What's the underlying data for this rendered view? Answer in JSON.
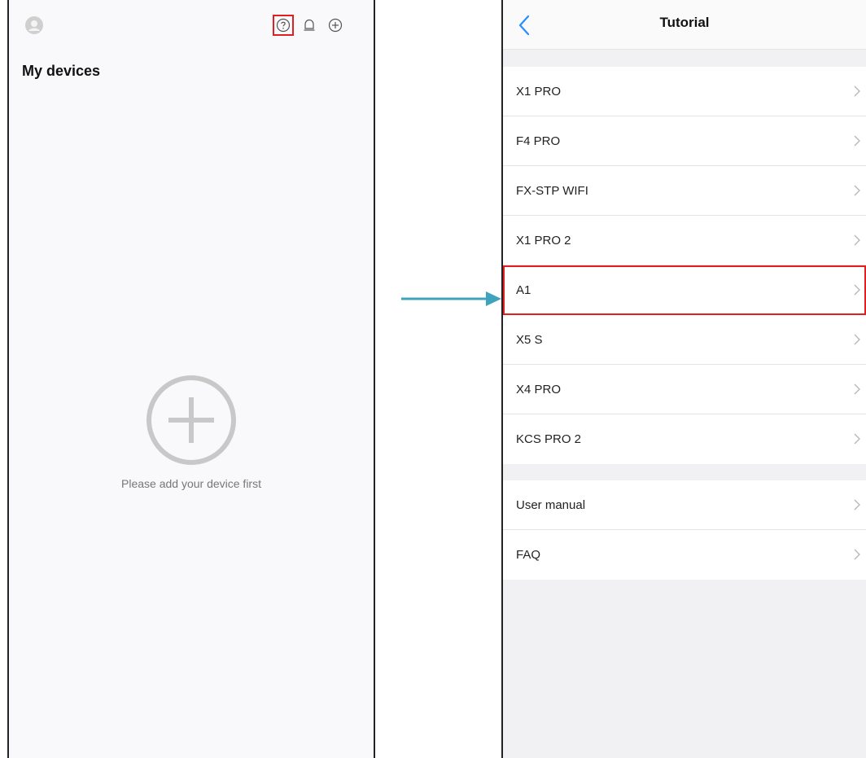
{
  "left": {
    "title": "My devices",
    "empty_message": "Please add your device first",
    "icons": {
      "avatar": "user-avatar-icon",
      "help": "question-circle-icon",
      "alarm": "bell-icon",
      "add": "plus-circle-icon"
    }
  },
  "right": {
    "nav_title": "Tutorial",
    "back_icon": "chevron-left-icon",
    "device_items": [
      {
        "label": "X1 PRO"
      },
      {
        "label": "F4 PRO"
      },
      {
        "label": "FX-STP WIFI"
      },
      {
        "label": "X1 PRO 2"
      },
      {
        "label": "A1",
        "highlighted": true
      },
      {
        "label": "X5 S"
      },
      {
        "label": "X4 PRO"
      },
      {
        "label": "KCS PRO 2"
      }
    ],
    "doc_items": [
      {
        "label": "User manual"
      },
      {
        "label": "FAQ"
      }
    ]
  },
  "colors": {
    "highlight": "#e02020",
    "arrow": "#3fa3bd",
    "back_arrow": "#2b8cff"
  }
}
